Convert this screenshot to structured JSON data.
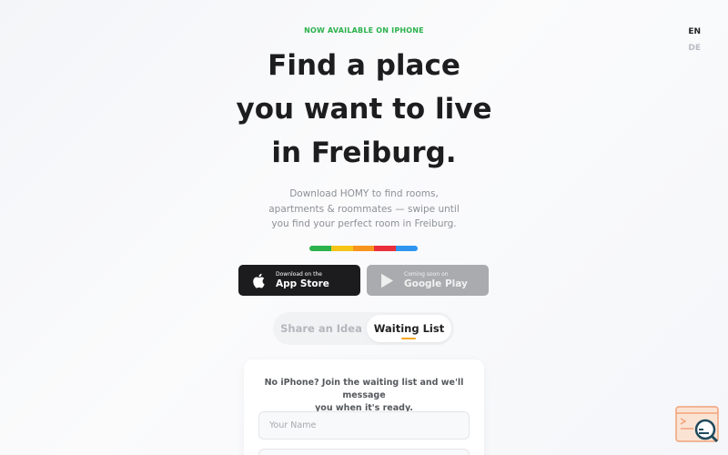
{
  "lang": {
    "current": "EN",
    "alternate": "DE"
  },
  "hero": {
    "tagline": "NOW AVAILABLE ON IPHONE",
    "headline_lines": [
      "Find a place",
      "you want to live",
      "in Freiburg."
    ],
    "subtext_lines": [
      "Download HOMY to find rooms,",
      "apartments & roommates — swipe until",
      "you find your perfect room in Freiburg."
    ],
    "colorbar": [
      "#2bb24c",
      "#f5c518",
      "#f7941d",
      "#ea2e3b",
      "#2f95ef"
    ]
  },
  "store": {
    "apple": {
      "small": "Download on the",
      "big": "App Store"
    },
    "google": {
      "small": "Coming soon on",
      "big": "Google Play"
    }
  },
  "tabs": {
    "idea": "Share an Idea",
    "waiting": "Waiting List"
  },
  "form": {
    "message_lines": [
      "No iPhone? Join the waiting list and we'll message",
      "you when it's ready."
    ],
    "name_placeholder": "Your Name",
    "email_placeholder": ""
  },
  "icons": {
    "apple": "apple-logo-icon",
    "google": "google-play-icon",
    "floating": "search-chat-icon"
  },
  "colors": {
    "accent_green": "#2bb24c",
    "accent_orange": "#f5a623",
    "dark_button": "#1c1c1e",
    "disabled_button": "#a9abae"
  }
}
